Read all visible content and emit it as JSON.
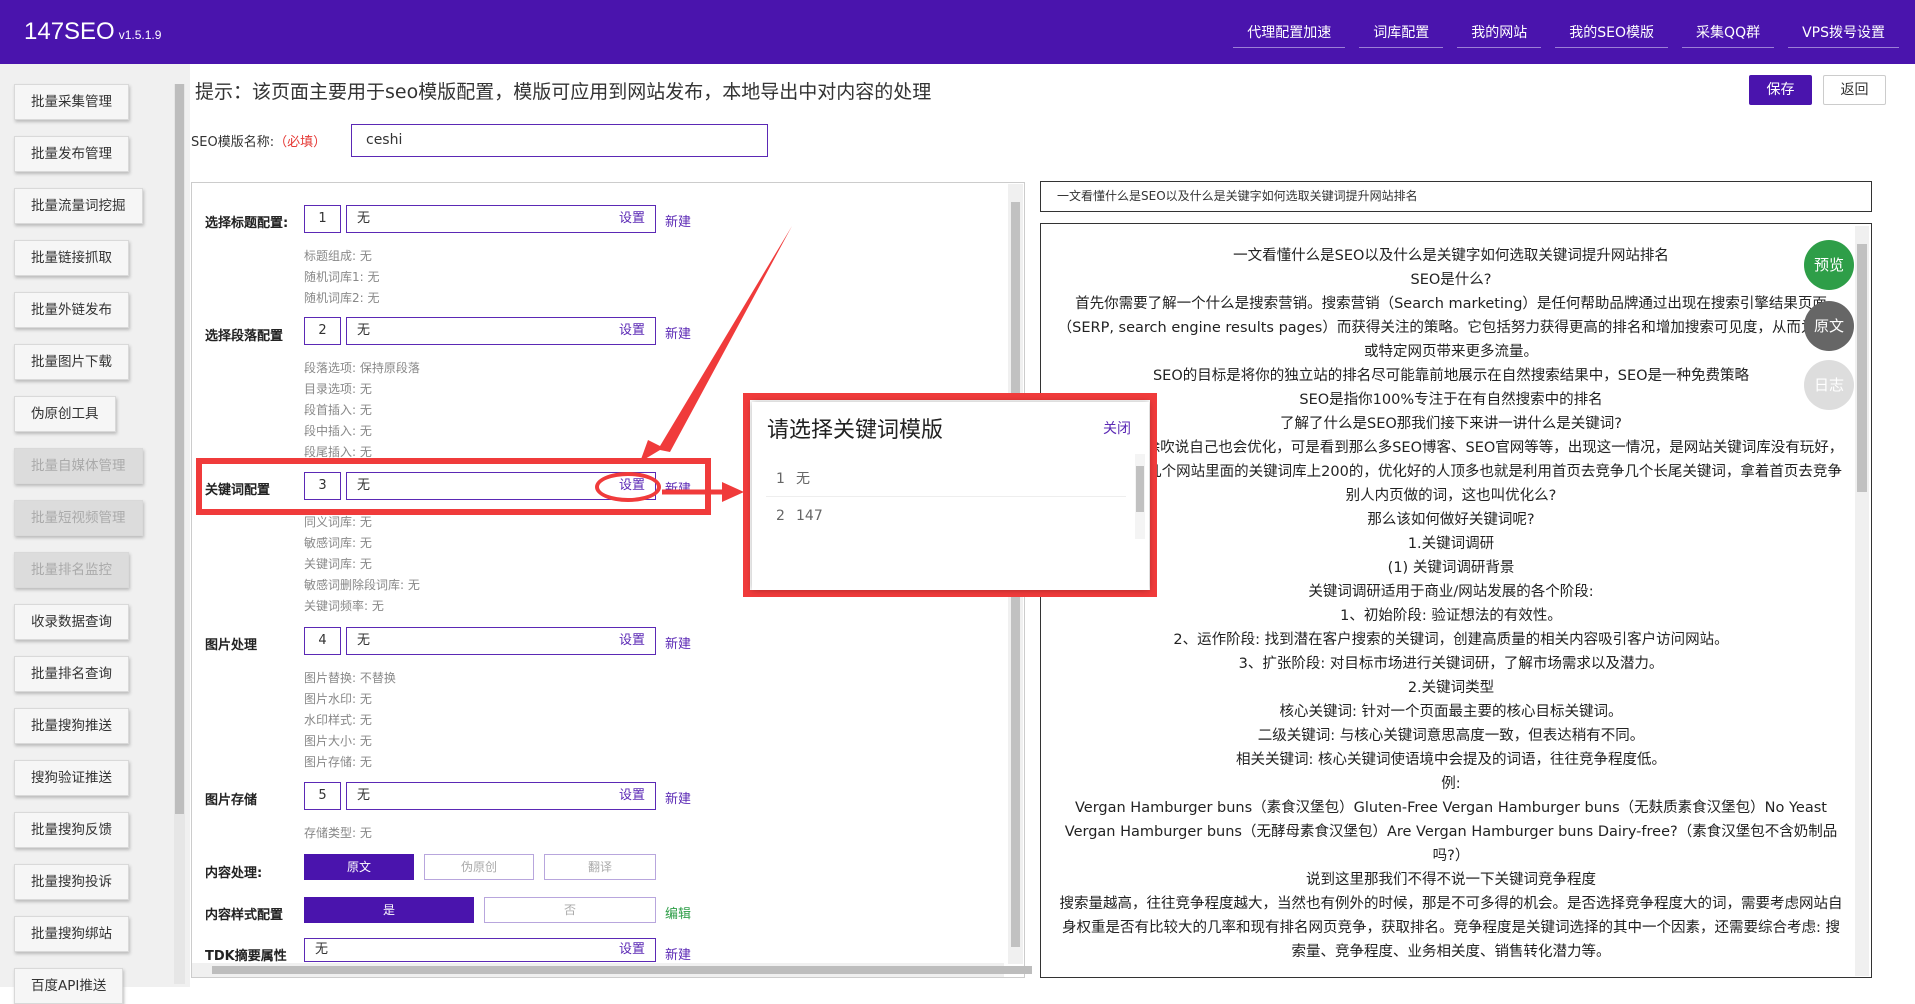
{
  "app": {
    "name": "147SEO",
    "version": "v1.5.1.9"
  },
  "topnav": [
    "代理配置加速",
    "词库配置",
    "我的网站",
    "我的SEO模版",
    "采集QQ群",
    "VPS拨号设置"
  ],
  "sidebar": {
    "items": [
      {
        "label": "批量采集管理",
        "disabled": false
      },
      {
        "label": "批量发布管理",
        "disabled": false
      },
      {
        "label": "批量流量词挖掘",
        "disabled": false
      },
      {
        "label": "批量链接抓取",
        "disabled": false
      },
      {
        "label": "批量外链发布",
        "disabled": false
      },
      {
        "label": "批量图片下载",
        "disabled": false
      },
      {
        "label": "伪原创工具",
        "disabled": false
      },
      {
        "label": "批量自媒体管理",
        "disabled": true
      },
      {
        "label": "批量短视频管理",
        "disabled": true
      },
      {
        "label": "批量排名监控",
        "disabled": true
      },
      {
        "label": "收录数据查询",
        "disabled": false
      },
      {
        "label": "批量排名查询",
        "disabled": false
      },
      {
        "label": "批量搜狗推送",
        "disabled": false
      },
      {
        "label": "搜狗验证推送",
        "disabled": false
      },
      {
        "label": "批量搜狗反馈",
        "disabled": false
      },
      {
        "label": "批量搜狗投诉",
        "disabled": false
      },
      {
        "label": "批量搜狗绑站",
        "disabled": false
      },
      {
        "label": "百度API推送",
        "disabled": false
      }
    ]
  },
  "header": {
    "tip": "提示：该页面主要用于seo模版配置，模版可应用到网站发布，本地导出中对内容的处理",
    "save": "保存",
    "back": "返回"
  },
  "template_name": {
    "label": "SEO模版名称:",
    "required": "（必填）",
    "value": "ceshi"
  },
  "config": {
    "set": "设置",
    "new": "新建",
    "edit": "编辑",
    "rows": [
      {
        "label": "选择标题配置:",
        "num": "1",
        "value": "无",
        "subs": [
          "标题组成: 无",
          "随机词库1: 无",
          "随机词库2: 无"
        ]
      },
      {
        "label": "选择段落配置",
        "num": "2",
        "value": "无",
        "subs": [
          "段落选项: 保持原段落",
          "目录选项: 无",
          "段首插入: 无",
          "段中插入: 无",
          "段尾插入: 无"
        ]
      },
      {
        "label": "关键词配置",
        "num": "3",
        "value": "无",
        "subs": [
          "同义词库: 无",
          "敏感词库: 无",
          "关键词库: 无",
          "敏感词删除段词库: 无",
          "关键词频率: 无"
        ]
      },
      {
        "label": "图片处理",
        "num": "4",
        "value": "无",
        "subs": [
          "图片替换: 不替换",
          "图片水印: 无",
          "水印样式: 无",
          "图片大小: 无",
          "图片存储: 无"
        ]
      },
      {
        "label": "图片存储",
        "num": "5",
        "value": "无",
        "subs": [
          "存储类型: 无"
        ]
      }
    ],
    "content_process": {
      "label": "内容处理:",
      "options": [
        "原文",
        "伪原创",
        "翻译"
      ],
      "selected": "原文"
    },
    "content_style": {
      "label": "内容样式配置",
      "options": [
        "是",
        "否"
      ],
      "selected": "是"
    },
    "tdk": {
      "label": "TDK摘要属性",
      "value": "无"
    }
  },
  "preview": {
    "title": "一文看懂什么是SEO以及什么是关键字如何选取关键词提升网站排名",
    "lines": [
      "一文看懂什么是SEO以及什么是关键字如何选取关键词提升网站排名",
      "SEO是什么?",
      "首先你需要了解一个什么是搜索营销。搜索营销（Search marketing）是任何帮助品牌通过出现在搜索引擎结果页面（SERP, search engine results pages）而获得关注的策略。它包括努力获得更高的排名和增加搜索可见度，从而为网站或特定网页带来更多流量。",
      "SEO的目标是将你的独立站的排名尽可能靠前地展示在自然搜索结果中，SEO是一种免费策略",
      "SEO是指你100%专注于在有自然搜索中的排名",
      "了解了什么是SEO那我们接下来讲一讲什么是关键词?",
      "大多数人都在徐吹说自己也会优化，可是看到那么多SEO博客、SEO官网等等，出现这一情况，是网站关键词库没有玩好，几乎没见到有几个网站里面的关键词库上200的，优化好的人顶多也就是利用首页去竞争几个长尾关键词，拿着首页去竞争别人内页做的词，这也叫优化么?",
      "那么该如何做好关键词呢?",
      "1.关键词调研",
      "(1) 关键词调研背景",
      "关键词调研适用于商业/网站发展的各个阶段:",
      "1、初始阶段: 验证想法的有效性。",
      "2、运作阶段: 找到潜在客户搜索的关键词，创建高质量的相关内容吸引客户访问网站。",
      "3、扩张阶段: 对目标市场进行关键词研，了解市场需求以及潜力。",
      "2.关键词类型",
      "核心关键词: 针对一个页面最主要的核心目标关键词。",
      "二级关键词: 与核心关键词意思高度一致，但表达稍有不同。",
      "相关关键词: 核心关键词使语境中会提及的词语，往往竞争程度低。",
      "例:",
      "Vergan Hamburger buns（素食汉堡包）Gluten-Free Vergan Hamburger buns（无麸质素食汉堡包）No Yeast Vergan Hamburger buns（无酵母素食汉堡包）Are Vergan Hamburger buns Dairy-free?（素食汉堡包不含奶制品吗?）",
      "说到这里那我们不得不说一下关键词竞争程度",
      "搜索量越高，往往竞争程度越大，当然也有例外的时候，那是不可多得的机会。是否选择竞争程度大的词，需要考虑网站自身权重是否有比较大的几率和现有排名网页竞争，获取排名。竞争程度是关键词选择的其中一个因素，还需要综合考虑: 搜索量、竞争程度、业务相关度、销售转化潜力等。"
    ],
    "fabs": [
      {
        "label": "预览",
        "color": "#2e9e48"
      },
      {
        "label": "原文",
        "color": "#666666"
      },
      {
        "label": "日志",
        "color": "#dddddd"
      }
    ]
  },
  "modal": {
    "title": "请选择关键词模版",
    "close": "关闭",
    "items": [
      {
        "index": "1",
        "name": "无"
      },
      {
        "index": "2",
        "name": "147"
      }
    ]
  }
}
